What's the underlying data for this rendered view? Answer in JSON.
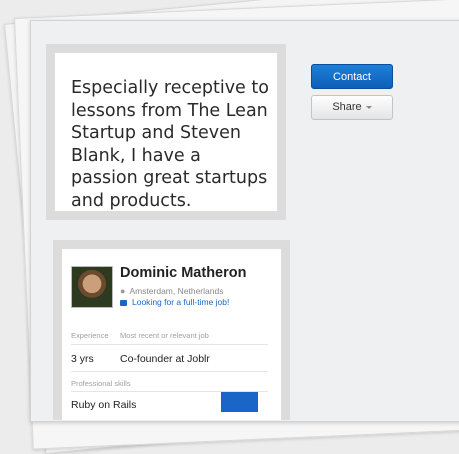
{
  "quote": {
    "text": "Especially receptive to lessons from The Lean Startup and Steven Blank, I have a passion great startups and products."
  },
  "actions": {
    "contact_label": "Contact",
    "share_label": "Share"
  },
  "profile": {
    "name": "Dominic Matheron",
    "location": "Amsterdam, Netherlands",
    "job_status": "Looking for a full-time job!",
    "experience_label": "Experience",
    "recent_job_label": "Most recent or relevant job",
    "experience_value": "3 yrs",
    "recent_job_value": "Co-founder at Joblr",
    "skills_label": "Professional skills",
    "skills": [
      {
        "name": "Ruby on Rails"
      }
    ]
  },
  "colors": {
    "accent": "#1a65c8",
    "paper": "#eef0f1",
    "frame": "#dcdcdc"
  },
  "icons": {
    "location": "map-pin-icon",
    "job": "briefcase-icon"
  }
}
